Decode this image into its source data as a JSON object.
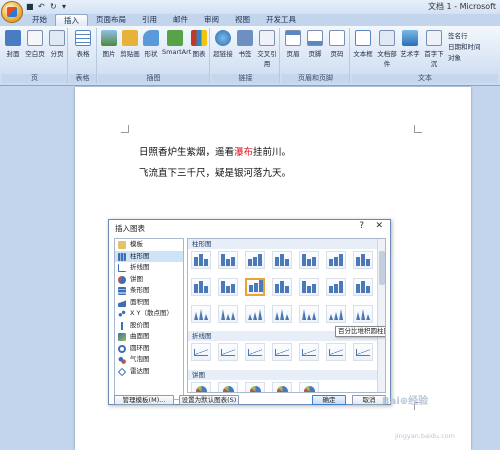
{
  "window": {
    "title": "文档 1 - Microsoft"
  },
  "tabs": [
    "开始",
    "插入",
    "页面布局",
    "引用",
    "邮件",
    "审阅",
    "视图",
    "开发工具"
  ],
  "active_tab": "插入",
  "ribbon": {
    "pages_group": {
      "title": "页",
      "buttons": [
        "封面",
        "空白页",
        "分页"
      ]
    },
    "table_group": {
      "title": "表格",
      "buttons": [
        "表格"
      ]
    },
    "illustrations_group": {
      "title": "插图",
      "buttons": [
        "图片",
        "剪贴画",
        "形状",
        "SmartArt",
        "图表"
      ]
    },
    "links_group": {
      "title": "链接",
      "buttons": [
        "超链接",
        "书签",
        "交叉引用"
      ]
    },
    "header_footer_group": {
      "title": "页眉和页脚",
      "buttons": [
        "页眉",
        "页脚",
        "页码"
      ]
    },
    "text_group": {
      "title": "文本",
      "buttons": [
        "文本框",
        "文档部件",
        "艺术字",
        "首字下沉"
      ],
      "small_buttons": [
        "签名行",
        "日期和时间",
        "对象"
      ]
    }
  },
  "document": {
    "line1_a": "日照香炉生紫烟，遥看",
    "line1_red": "瀑布",
    "line1_b": "挂前川。",
    "line2": "飞流直下三千尺，疑是银河落九天。"
  },
  "dialog": {
    "title": "插入图表",
    "help": "?",
    "close": "✕",
    "categories": [
      "模板",
      "柱形图",
      "折线图",
      "饼图",
      "条形图",
      "面积图",
      "X Y（散点图）",
      "股价图",
      "曲面图",
      "圆环图",
      "气泡图",
      "雷达图"
    ],
    "selected_category": "柱形图",
    "sections": [
      "柱形图",
      "折线图",
      "饼图"
    ],
    "tooltip": "百分比堆积圆柱图",
    "buttons": {
      "manage": "管理模板(M)...",
      "set_default": "设置为默认图表(S)",
      "ok": "确定",
      "cancel": "取消"
    }
  },
  "watermark": {
    "text": "Bai⊕经验",
    "url": "jingyan.baidu.com"
  },
  "colors": {
    "accent": "#2b5797",
    "red_text": "#e0191e",
    "selection": "#e8a33a"
  }
}
